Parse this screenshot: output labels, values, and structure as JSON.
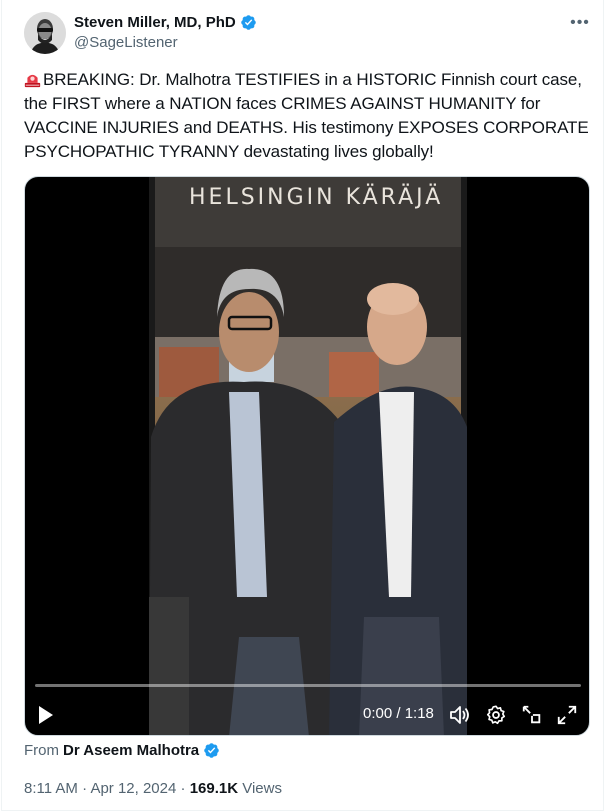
{
  "author": {
    "display_name": "Steven Miller, MD, PhD",
    "handle": "@SageListener",
    "verified": true
  },
  "tweet": {
    "emoji_icon": "police-car-light-emoji",
    "text": "BREAKING: Dr. Malhotra TESTIFIES in a HISTORIC Finnish court case, the FIRST where a NATION faces CRIMES AGAINST HUMANITY for VACCINE INJURIES and DEATHS. His testimony EXPOSES CORPORATE PSYCHOPATHIC TYRANNY devastating lives globally!"
  },
  "video": {
    "sign_text": "HELSINGIN KÄRÄJÄ",
    "time_display": "0:00 / 1:18",
    "controls": [
      "play-icon",
      "volume-icon",
      "settings-icon",
      "pip-icon",
      "fullscreen-icon"
    ]
  },
  "source": {
    "from_label": "From",
    "from_name": "Dr Aseem Malhotra",
    "verified": true
  },
  "meta": {
    "time": "8:11 AM",
    "separator1": " · ",
    "date": "Apr 12, 2024",
    "separator2": " · ",
    "views_count": "169.1K",
    "views_label": " Views"
  },
  "colors": {
    "verified_blue": "#1d9bf0",
    "text_primary": "#0f1419",
    "text_secondary": "#536471"
  }
}
